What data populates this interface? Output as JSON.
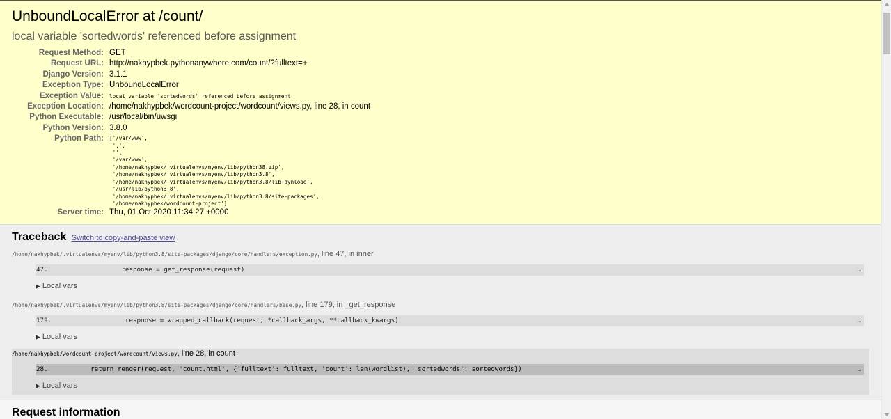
{
  "summary": {
    "title": "UnboundLocalError at /count/",
    "subtitle": "local variable 'sortedwords' referenced before assignment",
    "meta": [
      {
        "label": "Request Method:",
        "value": "GET",
        "mono": false
      },
      {
        "label": "Request URL:",
        "value": "http://nakhypbek.pythonanywhere.com/count/?fulltext=+",
        "mono": false
      },
      {
        "label": "Django Version:",
        "value": "3.1.1",
        "mono": false
      },
      {
        "label": "Exception Type:",
        "value": "UnboundLocalError",
        "mono": false
      },
      {
        "label": "Exception Value:",
        "value": "local variable 'sortedwords' referenced before assignment",
        "mono": true
      },
      {
        "label": "Exception Location:",
        "value": "/home/nakhypbek/wordcount-project/wordcount/views.py, line 28, in count",
        "mono": false
      },
      {
        "label": "Python Executable:",
        "value": "/usr/local/bin/uwsgi",
        "mono": false
      },
      {
        "label": "Python Version:",
        "value": "3.8.0",
        "mono": false
      }
    ],
    "python_path_label": "Python Path:",
    "python_path": "['/var/www',\n '.',\n '',\n '/var/www',\n '/home/nakhypbek/.virtualenvs/myenv/lib/python38.zip',\n '/home/nakhypbek/.virtualenvs/myenv/lib/python3.8',\n '/home/nakhypbek/.virtualenvs/myenv/lib/python3.8/lib-dynload',\n '/usr/lib/python3.8',\n '/home/nakhypbek/.virtualenvs/myenv/lib/python3.8/site-packages',\n '/home/nakhypbek/wordcount-project']",
    "server_time_label": "Server time:",
    "server_time": "Thu, 01 Oct 2020 11:34:27 +0000"
  },
  "traceback": {
    "title": "Traceback",
    "toggle_link": "Switch to copy-and-paste view",
    "local_vars_label": "Local vars",
    "frames": [
      {
        "path": "/home/nakhypbek/.virtualenvs/myenv/lib/python3.8/site-packages/django/core/handlers/exception.py",
        "location": ", line 47, in inner",
        "line_no": "47.",
        "code": "            response = get_response(request)",
        "ellipsis": "…"
      },
      {
        "path": "/home/nakhypbek/.virtualenvs/myenv/lib/python3.8/site-packages/django/core/handlers/base.py",
        "location": ", line 179, in _get_response",
        "line_no": "179.",
        "code": "             response = wrapped_callback(request, *callback_args, **callback_kwargs)",
        "ellipsis": "…"
      },
      {
        "path": "/home/nakhypbek/wordcount-project/wordcount/views.py",
        "location": ", line 28, in count",
        "line_no": "28.",
        "code": "    return render(request, 'count.html', {'fulltext': fulltext, 'count': len(wordlist), 'sortedwords': sortedwords})",
        "ellipsis": "…"
      }
    ]
  },
  "request_info": {
    "title": "Request information"
  },
  "colors": {
    "summary_bg": "#ffffcc",
    "traceback_bg": "#eeeeee",
    "user_frame_bg": "#dddddd",
    "link": "#4b4b99"
  }
}
